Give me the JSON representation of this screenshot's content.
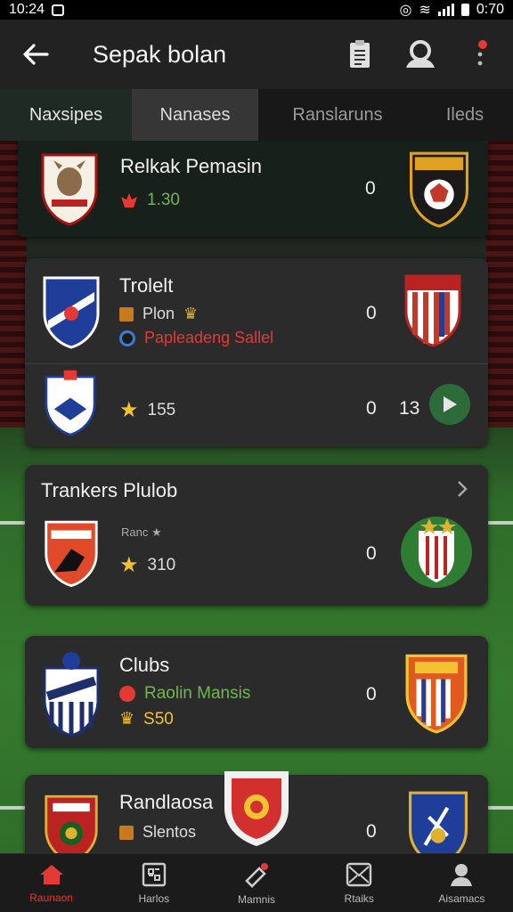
{
  "status": {
    "time": "10:24",
    "battery_time": "0:70"
  },
  "appbar": {
    "title": "Sepak bolan",
    "icons": [
      "back-arrow-icon",
      "clipboard-icon",
      "profile-icon",
      "notification-icon"
    ]
  },
  "tabs": [
    {
      "label": "Naxsipes"
    },
    {
      "label": "Nanases"
    },
    {
      "label": "Ranslaruns"
    },
    {
      "label": "Ileds"
    }
  ],
  "matches": [
    {
      "name": "Relkak Pemasin",
      "sub": "1.30",
      "score": "0",
      "sub_color": "#6fb84a"
    },
    {
      "name": "Trolelt",
      "sub": "Plon",
      "sub2": "Papleadeng Sallel",
      "score": "0"
    },
    {
      "sub": "155",
      "score": "0",
      "score2": "13"
    },
    {
      "name": "Trankers Plulob",
      "sub_small": "Ranc",
      "sub": "310",
      "score": "0"
    },
    {
      "name": "Clubs",
      "sub": "Raolin Mansis",
      "sub2": "S50",
      "score": "0"
    },
    {
      "name": "Randlaosa",
      "sub": "Slentos",
      "score": "0"
    }
  ],
  "bottom_nav": [
    {
      "label": "Raunaon",
      "icon": "home-icon",
      "active": true
    },
    {
      "label": "Harlos",
      "icon": "grid-icon"
    },
    {
      "label": "Mamnis",
      "icon": "whistle-icon"
    },
    {
      "label": "Rtaiks",
      "icon": "envelope-icon"
    },
    {
      "label": "Aisamacs",
      "icon": "person-icon"
    }
  ],
  "colors": {
    "accent": "#e53935",
    "green": "#6fb84a",
    "card": "#2b2b2b",
    "play": "#2e6b3b"
  }
}
